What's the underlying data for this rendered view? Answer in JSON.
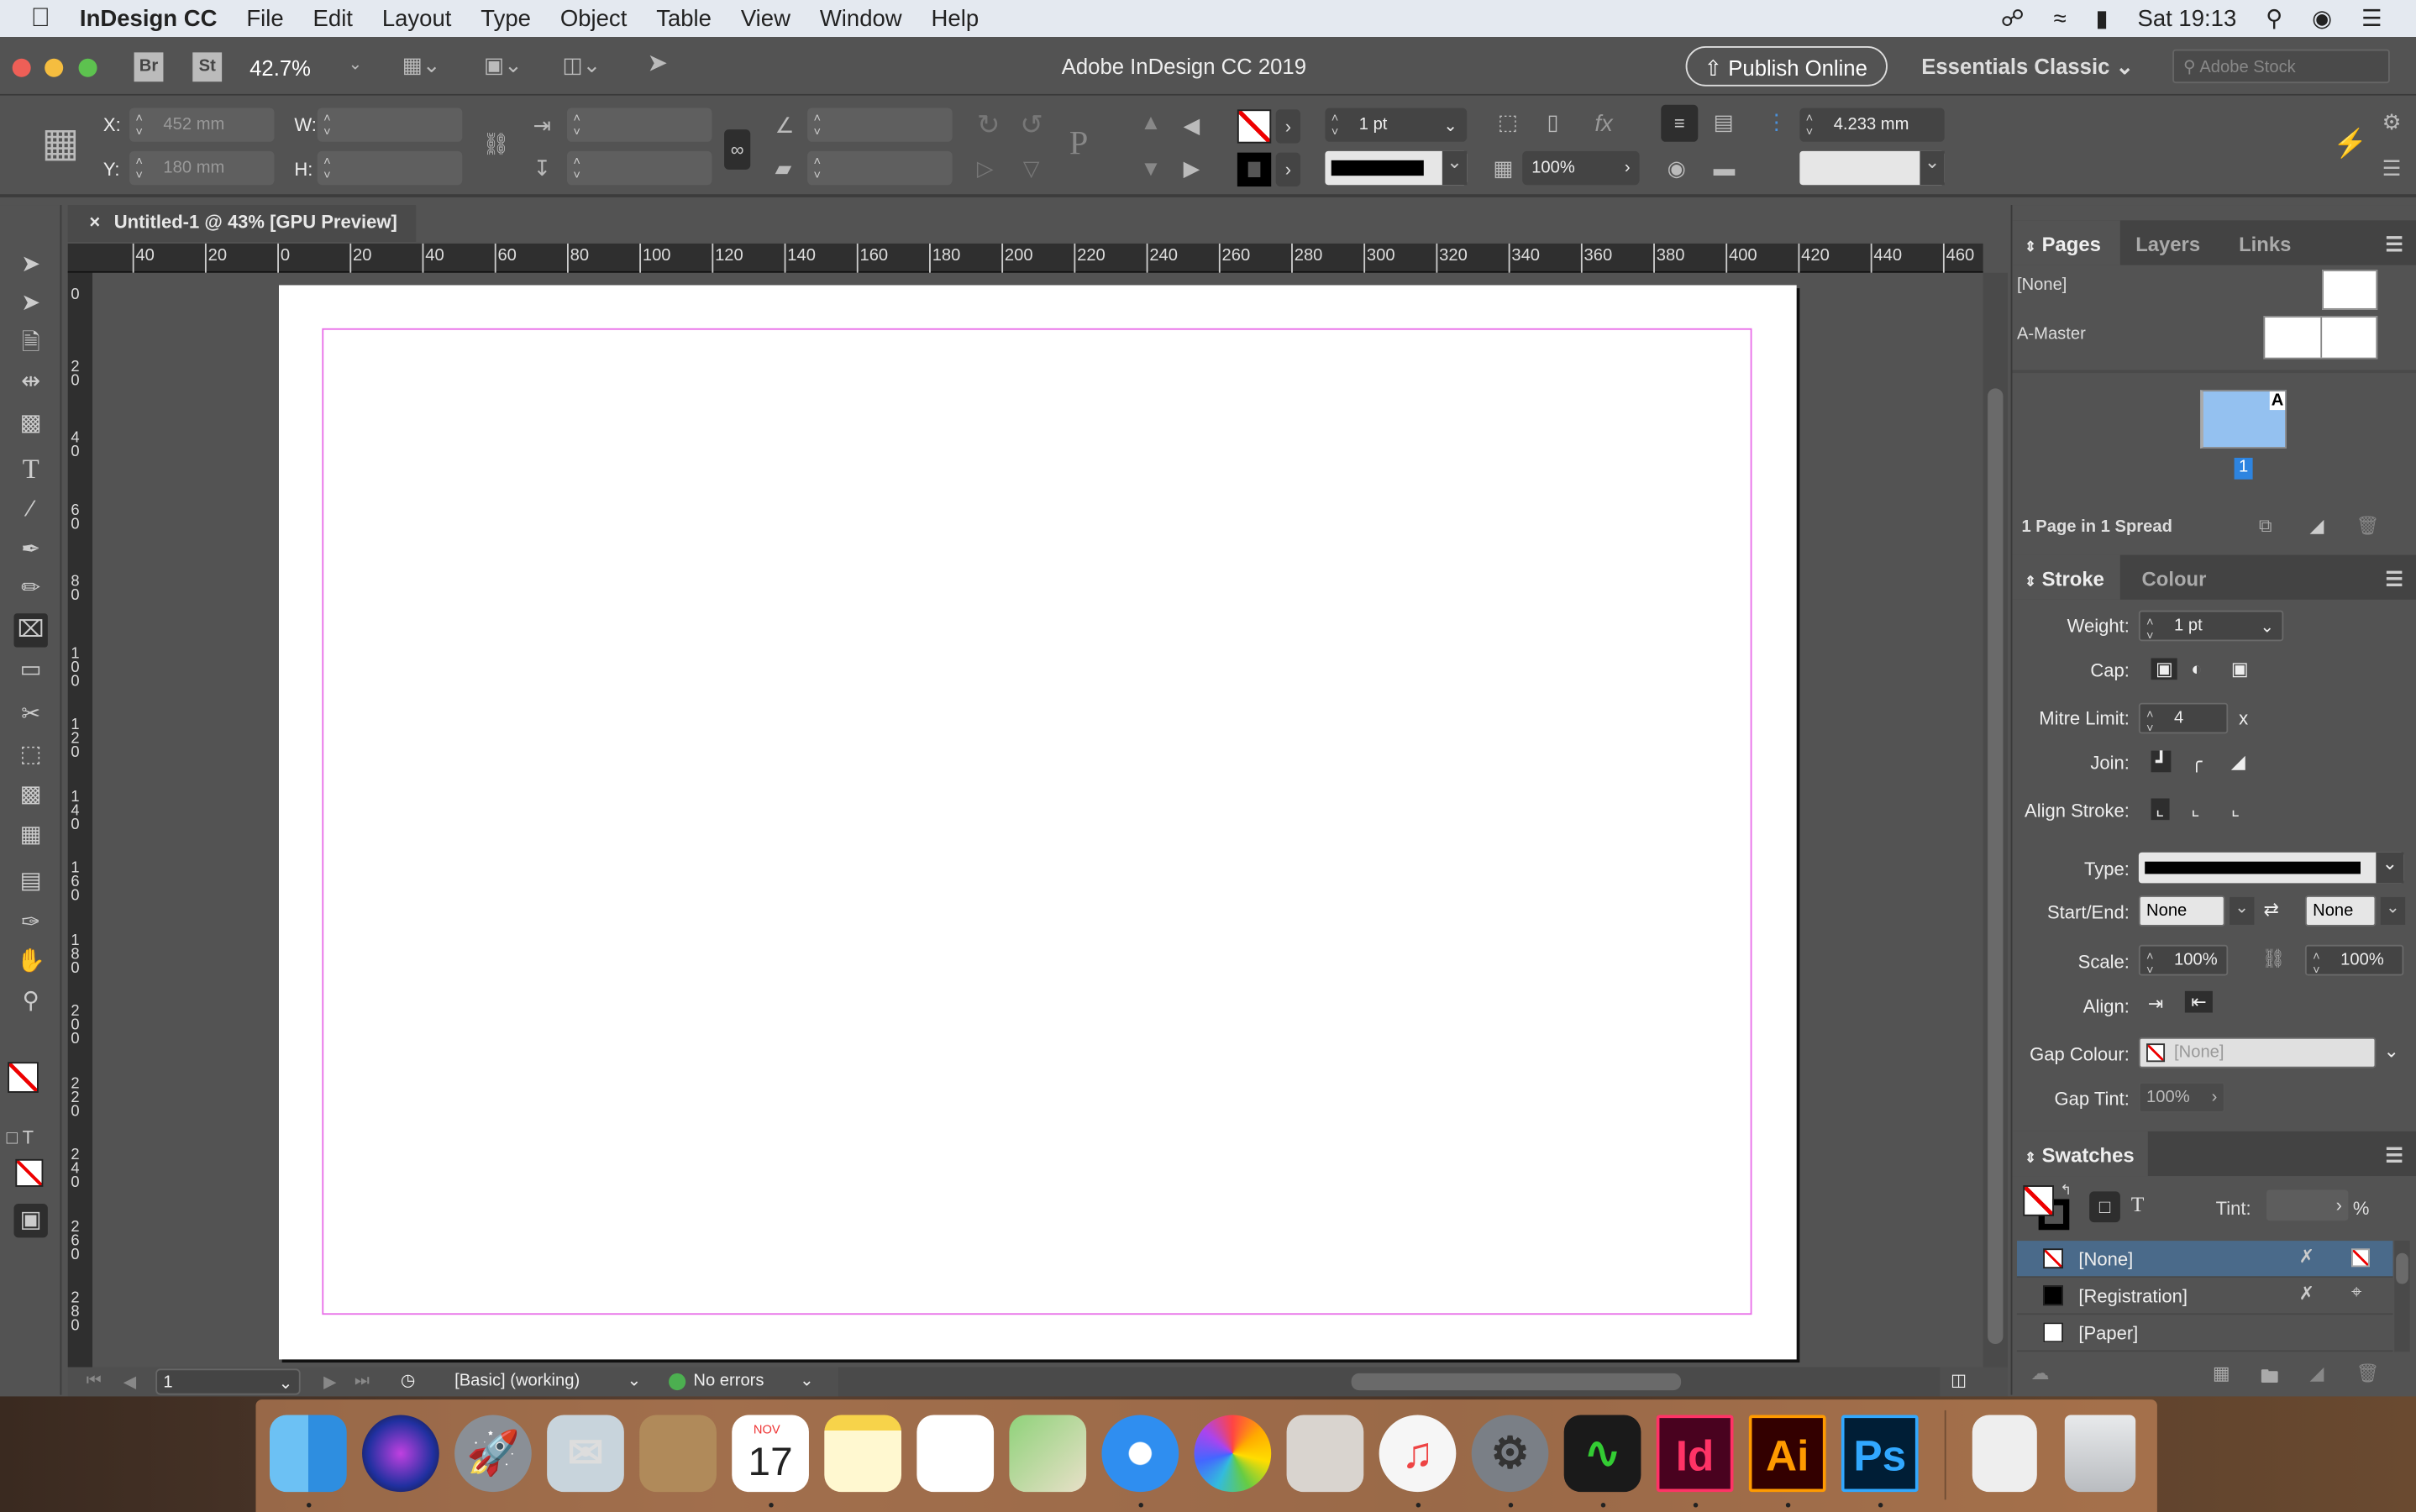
{
  "menubar": {
    "app": "InDesign CC",
    "items": [
      "File",
      "Edit",
      "Layout",
      "Type",
      "Object",
      "Table",
      "View",
      "Window",
      "Help"
    ],
    "time": "Sat 19:13"
  },
  "appbar": {
    "bridge": "Br",
    "stock": "St",
    "zoom": "42.7%",
    "title": "Adobe InDesign CC 2019",
    "publish": "Publish Online",
    "workspace": "Essentials Classic",
    "search_placeholder": "Adobe Stock"
  },
  "control": {
    "x_label": "X:",
    "x": "452 mm",
    "y_label": "Y:",
    "y": "180 mm",
    "w_label": "W:",
    "h_label": "H:",
    "stroke_weight": "1 pt",
    "opacity": "100%",
    "spacing": "4.233 mm",
    "fx": "fx"
  },
  "document": {
    "tab": "Untitled-1 @ 43% [GPU Preview]"
  },
  "rulers": {
    "h": [
      "40",
      "20",
      "0",
      "20",
      "40",
      "60",
      "80",
      "100",
      "120",
      "140",
      "160",
      "180",
      "200",
      "220",
      "240",
      "260",
      "280",
      "300",
      "320",
      "340",
      "360",
      "380",
      "400",
      "420",
      "440",
      "460"
    ],
    "v": [
      "0",
      "20",
      "40",
      "60",
      "80",
      "100",
      "120",
      "140",
      "160",
      "180",
      "200",
      "220",
      "240",
      "260",
      "280"
    ]
  },
  "status": {
    "page": "1",
    "preflight_profile": "[Basic] (working)",
    "errors": "No errors",
    "colors": {
      "ok": "#4caf50"
    }
  },
  "pages_panel": {
    "tabs": [
      "Pages",
      "Layers",
      "Links"
    ],
    "none": "[None]",
    "master": "A-Master",
    "page_master_letter": "A",
    "page_number": "1",
    "summary": "1 Page in 1 Spread"
  },
  "stroke_panel": {
    "tabs": [
      "Stroke",
      "Colour"
    ],
    "weight_label": "Weight:",
    "weight": "1 pt",
    "cap_label": "Cap:",
    "mitre_label": "Mitre Limit:",
    "mitre": "4",
    "mitre_suffix": "x",
    "join_label": "Join:",
    "align_label": "Align Stroke:",
    "type_label": "Type:",
    "startend_label": "Start/End:",
    "start": "None",
    "end": "None",
    "scale_label": "Scale:",
    "scale1": "100%",
    "scale2": "100%",
    "align2_label": "Align:",
    "gap_colour_label": "Gap Colour:",
    "gap_colour": "[None]",
    "gap_tint_label": "Gap Tint:",
    "gap_tint": "100%"
  },
  "swatches_panel": {
    "title": "Swatches",
    "tint_label": "Tint:",
    "tint_suffix": "%",
    "items": [
      {
        "name": "[None]",
        "selected": true
      },
      {
        "name": "[Registration]"
      },
      {
        "name": "[Paper]"
      }
    ],
    "colors": {
      "selected": "#4a6a8a"
    }
  },
  "dock": {
    "items": [
      "Finder",
      "Siri",
      "Launchpad",
      "Mail",
      "Contacts",
      "Calendar",
      "Notes",
      "Reminders",
      "Maps",
      "Safari",
      "Photos",
      "Calculator",
      "iTunes",
      "System Preferences",
      "Activity Monitor",
      "Id",
      "Ai",
      "Ps",
      "Archive Utility",
      "Trash"
    ],
    "calendar_month": "NOV",
    "calendar_day": "17"
  }
}
